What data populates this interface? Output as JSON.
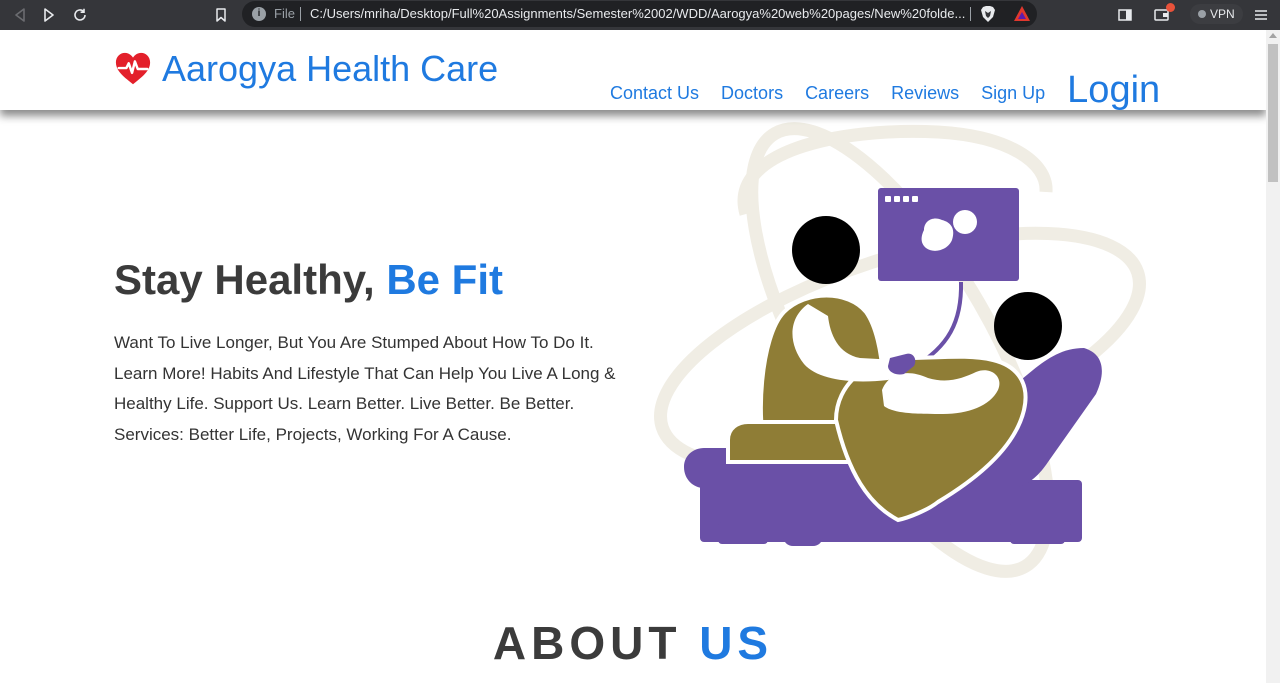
{
  "browser": {
    "file_label": "File",
    "url": "C:/Users/mriha/Desktop/Full%20Assignments/Semester%2002/WDD/Aarogya%20web%20pages/New%20folde...",
    "vpn_label": "VPN"
  },
  "header": {
    "brand": "Aarogya Health Care",
    "nav": {
      "contact": "Contact Us",
      "doctors": "Doctors",
      "careers": "Careers",
      "reviews": "Reviews",
      "signup": "Sign Up",
      "login": "Login"
    }
  },
  "hero": {
    "title_part1": "Stay Healthy, ",
    "title_accent": "Be Fit",
    "paragraph": "Want To Live Longer, But You Are Stumped About How To Do It. Learn More! Habits And Lifestyle That Can Help You Live A Long & Healthy Life. Support Us. Learn Better. Live Better. Be Better. Services: Better Life, Projects, Working For A Cause."
  },
  "about": {
    "title_part1": "ABOUT ",
    "title_accent": "US"
  },
  "colors": {
    "accent": "#1f7ae0",
    "heading": "#3b3b3b",
    "olive": "#8f7d36",
    "purple": "#6a50a7",
    "heart": "#e3202b"
  },
  "icons": [
    "back-icon",
    "forward-icon",
    "reload-icon",
    "bookmark-icon",
    "info-icon",
    "brave-shield-icon",
    "brave-rewards-icon",
    "sidebar-icon",
    "wallet-icon",
    "menu-icon",
    "heart-pulse-icon"
  ]
}
